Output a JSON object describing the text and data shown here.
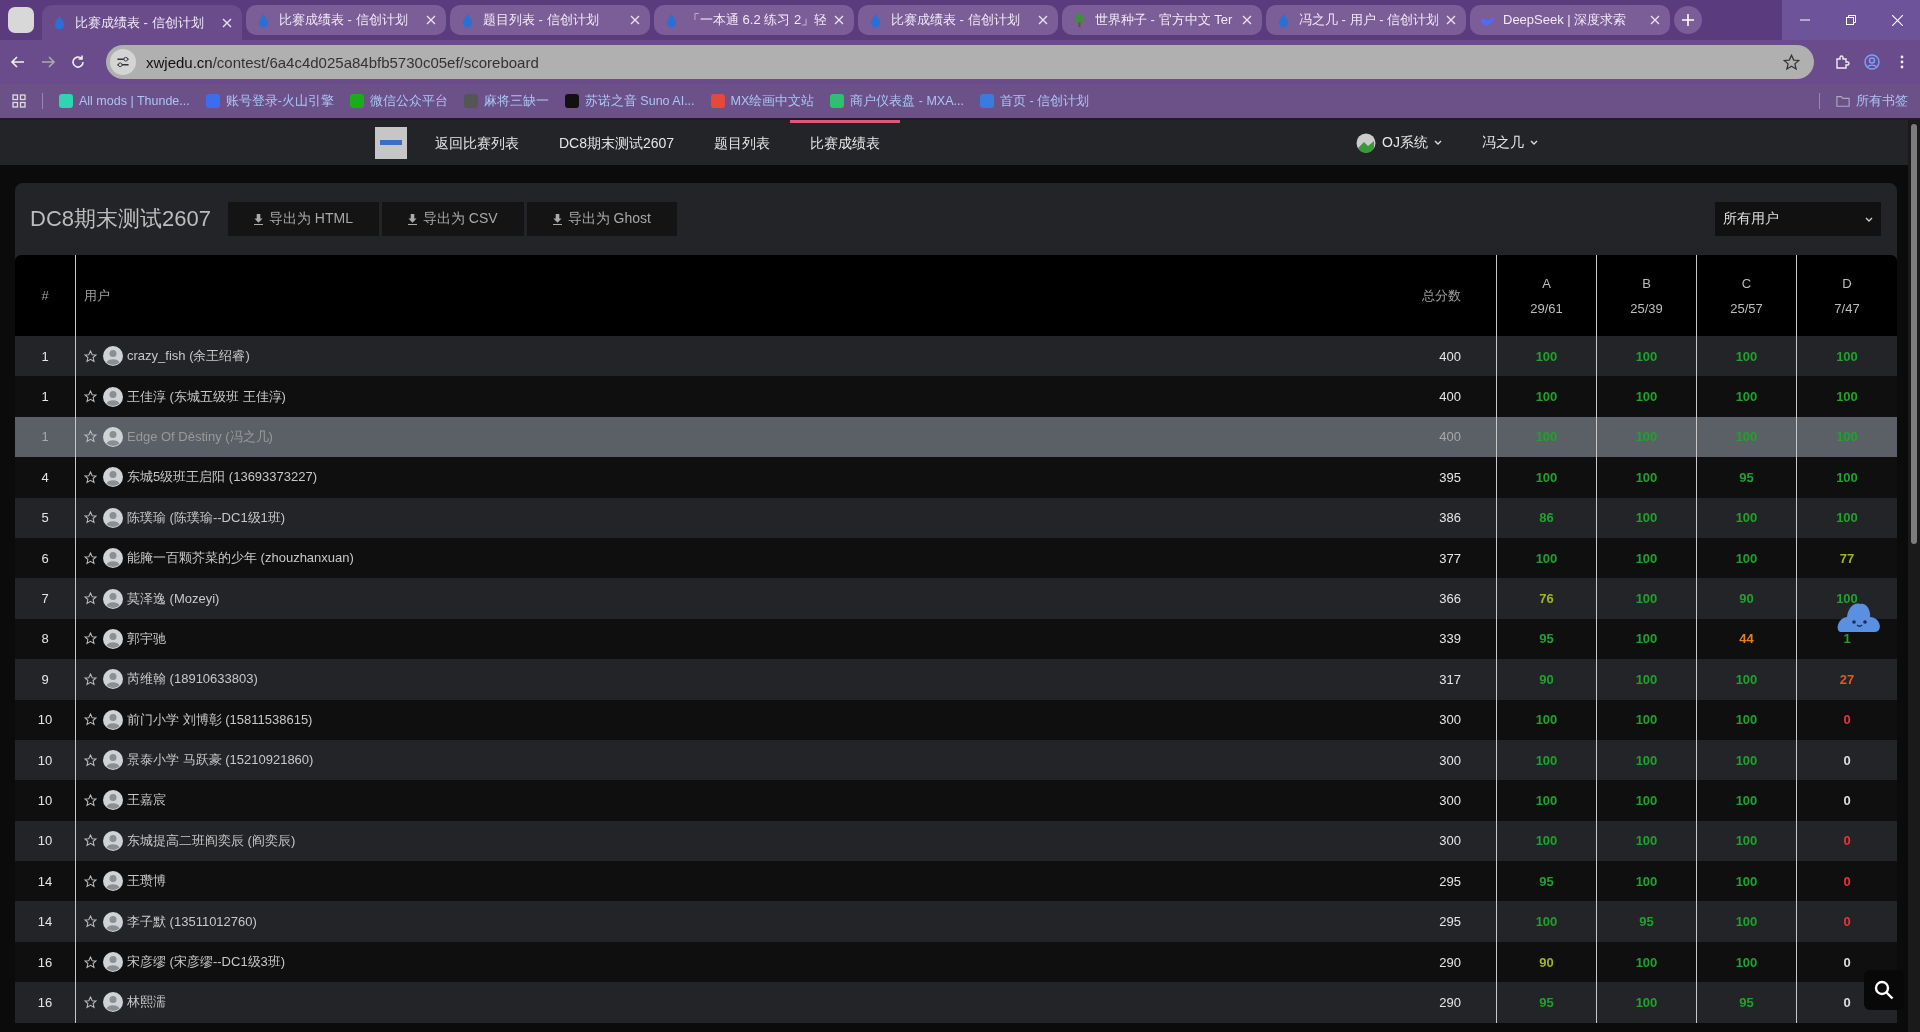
{
  "browser": {
    "tabs": [
      {
        "title": "比赛成绩表 - 信创计划",
        "selected": true,
        "kind": "drop"
      },
      {
        "title": "比赛成绩表 - 信创计划",
        "selected": false,
        "kind": "drop"
      },
      {
        "title": "题目列表 - 信创计划",
        "selected": false,
        "kind": "drop"
      },
      {
        "title": "「一本通 6.2 练习 2」轻",
        "selected": false,
        "kind": "drop"
      },
      {
        "title": "比赛成绩表 - 信创计划",
        "selected": false,
        "kind": "drop"
      },
      {
        "title": "世界种子 - 官方中文 Ter",
        "selected": false,
        "kind": "tree"
      },
      {
        "title": "冯之几 - 用户 - 信创计划",
        "selected": false,
        "kind": "drop"
      },
      {
        "title": "DeepSeek | 深度求索",
        "selected": false,
        "kind": "whale"
      }
    ],
    "address": {
      "host": "xwjedu.cn",
      "path": "/contest/6a4c4d025a84bfb5730c05ef/scoreboard"
    },
    "bookmarks": [
      {
        "label": "All mods | Thunde...",
        "color": "#2fd4b0"
      },
      {
        "label": "账号登录-火山引擎",
        "color": "#3a6df0"
      },
      {
        "label": "微信公众平台",
        "color": "#1aad19"
      },
      {
        "label": "麻将三缺一",
        "color": "#555555"
      },
      {
        "label": "苏诺之音 Suno AI...",
        "color": "#111111"
      },
      {
        "label": "MX绘画中文站",
        "color": "#e8483c"
      },
      {
        "label": "商户仪表盘 - MXA...",
        "color": "#2fbf71"
      },
      {
        "label": "首页 - 信创计划",
        "color": "#3a7be0"
      }
    ],
    "all_bookmarks": "所有书签"
  },
  "nav": {
    "links": [
      {
        "label": "返回比赛列表",
        "selected": false
      },
      {
        "label": "DC8期末测试2607",
        "selected": false
      },
      {
        "label": "题目列表",
        "selected": false
      },
      {
        "label": "比赛成绩表",
        "selected": true
      }
    ],
    "system_menu": "OJ系统",
    "user_menu": "冯之几"
  },
  "contest": {
    "title": "DC8期末测试2607",
    "export_buttons": [
      "导出为 HTML",
      "导出为 CSV",
      "导出为 Ghost"
    ],
    "filter": {
      "value": "所有用户"
    }
  },
  "table": {
    "columns": {
      "rank": "#",
      "user": "用户",
      "total": "总分数",
      "problems": [
        {
          "letter": "A",
          "ratio": "29/61"
        },
        {
          "letter": "B",
          "ratio": "25/39"
        },
        {
          "letter": "C",
          "ratio": "25/57"
        },
        {
          "letter": "D",
          "ratio": "7/47"
        }
      ]
    },
    "rows": [
      {
        "rank": "1",
        "user": "crazy_fish (余王绍睿)",
        "total": "400",
        "selected": false,
        "scores": [
          {
            "text": "100",
            "color": "#1fa22b"
          },
          {
            "text": "100",
            "color": "#1fa22b"
          },
          {
            "text": "100",
            "color": "#1fa22b"
          },
          {
            "text": "100",
            "color": "#1fa22b"
          }
        ]
      },
      {
        "rank": "1",
        "user": "王佳淳 (东城五级班 王佳淳)",
        "total": "400",
        "selected": false,
        "scores": [
          {
            "text": "100",
            "color": "#1fa22b"
          },
          {
            "text": "100",
            "color": "#1fa22b"
          },
          {
            "text": "100",
            "color": "#1fa22b"
          },
          {
            "text": "100",
            "color": "#1fa22b"
          }
        ]
      },
      {
        "rank": "1",
        "user": "Edge Of Děstiny (冯之几)",
        "total": "400",
        "selected": true,
        "scores": [
          {
            "text": "100",
            "color": "#1fa22b"
          },
          {
            "text": "100",
            "color": "#1fa22b"
          },
          {
            "text": "100",
            "color": "#1fa22b"
          },
          {
            "text": "100",
            "color": "#1fa22b"
          }
        ]
      },
      {
        "rank": "4",
        "user": "东城5级班王启阳 (13693373227)",
        "total": "395",
        "selected": false,
        "scores": [
          {
            "text": "100",
            "color": "#1fa22b"
          },
          {
            "text": "100",
            "color": "#1fa22b"
          },
          {
            "text": "95",
            "color": "#1fa22b"
          },
          {
            "text": "100",
            "color": "#1fa22b"
          }
        ]
      },
      {
        "rank": "5",
        "user": "陈璞瑜 (陈璞瑜--DC1级1班)",
        "total": "386",
        "selected": false,
        "scores": [
          {
            "text": "86",
            "color": "#1fa22b"
          },
          {
            "text": "100",
            "color": "#1fa22b"
          },
          {
            "text": "100",
            "color": "#1fa22b"
          },
          {
            "text": "100",
            "color": "#1fa22b"
          }
        ]
      },
      {
        "rank": "6",
        "user": "能腌一百颗芥菜的少年 (zhouzhanxuan)",
        "total": "377",
        "selected": false,
        "scores": [
          {
            "text": "100",
            "color": "#1fa22b"
          },
          {
            "text": "100",
            "color": "#1fa22b"
          },
          {
            "text": "100",
            "color": "#1fa22b"
          },
          {
            "text": "77",
            "color": "#9cb71a"
          }
        ]
      },
      {
        "rank": "7",
        "user": "莫泽逸 (Mozeyi)",
        "total": "366",
        "selected": false,
        "scores": [
          {
            "text": "76",
            "color": "#9cb71a"
          },
          {
            "text": "100",
            "color": "#1fa22b"
          },
          {
            "text": "90",
            "color": "#1fa22b"
          },
          {
            "text": "100",
            "color": "#1fa22b"
          }
        ]
      },
      {
        "rank": "8",
        "user": "郭宇驰",
        "total": "339",
        "selected": false,
        "scores": [
          {
            "text": "95",
            "color": "#1fa22b"
          },
          {
            "text": "100",
            "color": "#1fa22b"
          },
          {
            "text": "44",
            "color": "#e8820c"
          },
          {
            "text": "1",
            "color": "#1fa22b"
          }
        ]
      },
      {
        "rank": "9",
        "user": "芮维翰 (18910633803)",
        "total": "317",
        "selected": false,
        "scores": [
          {
            "text": "90",
            "color": "#1fa22b"
          },
          {
            "text": "100",
            "color": "#1fa22b"
          },
          {
            "text": "100",
            "color": "#1fa22b"
          },
          {
            "text": "27",
            "color": "#f0502a"
          }
        ]
      },
      {
        "rank": "10",
        "user": "前门小学 刘博彰 (15811538615)",
        "total": "300",
        "selected": false,
        "scores": [
          {
            "text": "100",
            "color": "#1fa22b"
          },
          {
            "text": "100",
            "color": "#1fa22b"
          },
          {
            "text": "100",
            "color": "#1fa22b"
          },
          {
            "text": "0",
            "color": "#f0303a"
          }
        ]
      },
      {
        "rank": "10",
        "user": "景泰小学 马跃豪 (15210921860)",
        "total": "300",
        "selected": false,
        "scores": [
          {
            "text": "100",
            "color": "#1fa22b"
          },
          {
            "text": "100",
            "color": "#1fa22b"
          },
          {
            "text": "100",
            "color": "#1fa22b"
          },
          {
            "text": "0",
            "color": "#dddddd"
          }
        ]
      },
      {
        "rank": "10",
        "user": "王嘉宸",
        "total": "300",
        "selected": false,
        "scores": [
          {
            "text": "100",
            "color": "#1fa22b"
          },
          {
            "text": "100",
            "color": "#1fa22b"
          },
          {
            "text": "100",
            "color": "#1fa22b"
          },
          {
            "text": "0",
            "color": "#dddddd"
          }
        ]
      },
      {
        "rank": "10",
        "user": "东城提高二班阎奕辰 (阎奕辰)",
        "total": "300",
        "selected": false,
        "scores": [
          {
            "text": "100",
            "color": "#1fa22b"
          },
          {
            "text": "100",
            "color": "#1fa22b"
          },
          {
            "text": "100",
            "color": "#1fa22b"
          },
          {
            "text": "0",
            "color": "#f0303a"
          }
        ]
      },
      {
        "rank": "14",
        "user": "王瓒博",
        "total": "295",
        "selected": false,
        "scores": [
          {
            "text": "95",
            "color": "#1fa22b"
          },
          {
            "text": "100",
            "color": "#1fa22b"
          },
          {
            "text": "100",
            "color": "#1fa22b"
          },
          {
            "text": "0",
            "color": "#f0303a"
          }
        ]
      },
      {
        "rank": "14",
        "user": "李子默 (13511012760)",
        "total": "295",
        "selected": false,
        "scores": [
          {
            "text": "100",
            "color": "#1fa22b"
          },
          {
            "text": "95",
            "color": "#1fa22b"
          },
          {
            "text": "100",
            "color": "#1fa22b"
          },
          {
            "text": "0",
            "color": "#f0303a"
          }
        ]
      },
      {
        "rank": "16",
        "user": "宋彦缪 (宋彦缪--DC1级3班)",
        "total": "290",
        "selected": false,
        "scores": [
          {
            "text": "90",
            "color": "#9cb71a"
          },
          {
            "text": "100",
            "color": "#1fa22b"
          },
          {
            "text": "100",
            "color": "#1fa22b"
          },
          {
            "text": "0",
            "color": "#dddddd"
          }
        ]
      },
      {
        "rank": "16",
        "user": "林熙濡",
        "total": "290",
        "selected": false,
        "scores": [
          {
            "text": "95",
            "color": "#1fa22b"
          },
          {
            "text": "100",
            "color": "#1fa22b"
          },
          {
            "text": "95",
            "color": "#1fa22b"
          },
          {
            "text": "0",
            "color": "#dddddd"
          }
        ]
      }
    ]
  }
}
